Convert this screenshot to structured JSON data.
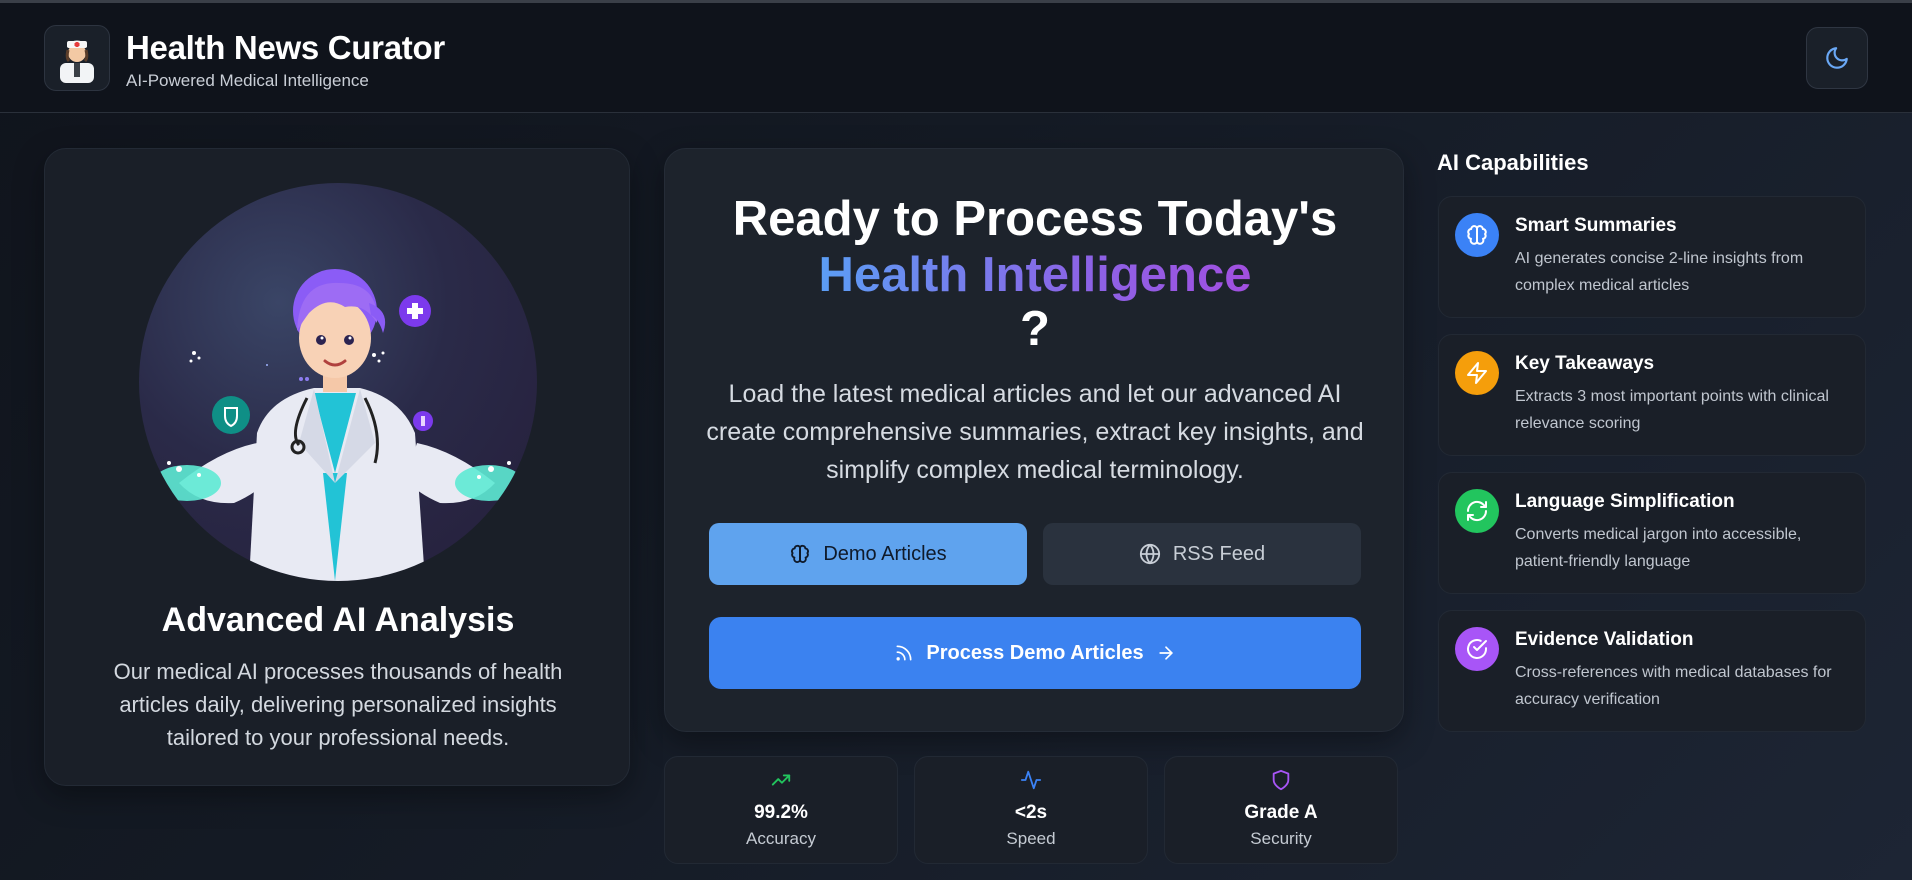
{
  "app": {
    "title": "Health News Curator",
    "subtitle": "AI-Powered Medical Intelligence",
    "logo_icon": "nurse-icon",
    "theme_toggle_icon": "moon-icon"
  },
  "left_card": {
    "illustration": "doctor-illustration",
    "title": "Advanced AI Analysis",
    "description": "Our medical AI processes thousands of health articles daily, delivering personalized insights tailored to your professional needs."
  },
  "hero": {
    "title_line1": "Ready to Process Today's",
    "title_highlight": "Health Intelligence",
    "title_end": "?",
    "description": "Load the latest medical articles and let our advanced AI create comprehensive summaries, extract key insights, and simplify complex medical terminology.",
    "sources": [
      {
        "label": "Demo Articles",
        "icon": "brain-icon",
        "selected": true
      },
      {
        "label": "RSS Feed",
        "icon": "globe-icon",
        "selected": false
      }
    ],
    "process_button": {
      "label": "Process Demo Articles",
      "icon": "rss-icon",
      "trailing_icon": "arrow-right-icon"
    }
  },
  "stats": [
    {
      "value": "99.2%",
      "label": "Accuracy",
      "icon": "trending-up-icon",
      "color": "#22c55e"
    },
    {
      "value": "<2s",
      "label": "Speed",
      "icon": "activity-icon",
      "color": "#3b82f6"
    },
    {
      "value": "Grade A",
      "label": "Security",
      "icon": "shield-icon",
      "color": "#a855f7"
    }
  ],
  "capabilities": {
    "heading": "AI Capabilities",
    "items": [
      {
        "title": "Smart Summaries",
        "description": "AI generates concise 2-line insights from complex medical articles",
        "icon": "brain-icon",
        "color": "#3b82f6"
      },
      {
        "title": "Key Takeaways",
        "description": "Extracts 3 most important points with clinical relevance scoring",
        "icon": "lightning-icon",
        "color": "#f59e0b"
      },
      {
        "title": "Language Simplification",
        "description": "Converts medical jargon into accessible, patient-friendly language",
        "icon": "refresh-icon",
        "color": "#22c55e"
      },
      {
        "title": "Evidence Validation",
        "description": "Cross-references with medical databases for accuracy verification",
        "icon": "check-circle-icon",
        "color": "#a855f7"
      }
    ]
  }
}
